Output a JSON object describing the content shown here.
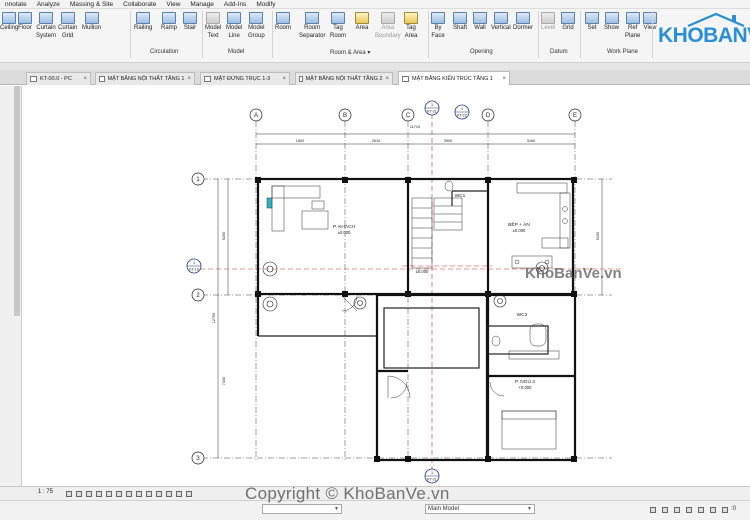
{
  "menu": [
    "nnotate",
    "Analyze",
    "Massing & Site",
    "Collaborate",
    "View",
    "Manage",
    "Add-Ins",
    "Modify"
  ],
  "ribbon": {
    "buttons": [
      {
        "label1": "Ceiling",
        "label2": "",
        "icon": "ceiling-icon",
        "color": "blue"
      },
      {
        "label1": "Floor",
        "label2": "",
        "icon": "floor-icon",
        "color": "blue"
      },
      {
        "label1": "Curtain",
        "label2": "System",
        "icon": "curtain-system-icon",
        "color": "blue"
      },
      {
        "label1": "Curtain",
        "label2": "Grid",
        "icon": "curtain-grid-icon",
        "color": "blue"
      },
      {
        "label1": "Mullion",
        "label2": "",
        "icon": "mullion-icon",
        "color": "blue"
      },
      {
        "label1": "Railing",
        "label2": "",
        "icon": "railing-icon",
        "color": "blue"
      },
      {
        "label1": "Ramp",
        "label2": "",
        "icon": "ramp-icon",
        "color": "blue"
      },
      {
        "label1": "Stair",
        "label2": "",
        "icon": "stair-icon",
        "color": "blue"
      },
      {
        "label1": "Model",
        "label2": "Text",
        "icon": "model-text-icon",
        "color": "gray"
      },
      {
        "label1": "Model",
        "label2": "Line",
        "icon": "model-line-icon",
        "color": "blue"
      },
      {
        "label1": "Model",
        "label2": "Group",
        "icon": "model-group-icon",
        "color": "blue"
      },
      {
        "label1": "Room",
        "label2": "",
        "icon": "room-icon",
        "color": "blue"
      },
      {
        "label1": "Room",
        "label2": "Separator",
        "icon": "room-separator-icon",
        "color": "blue"
      },
      {
        "label1": "Tag",
        "label2": "Room",
        "icon": "tag-room-icon",
        "color": "blue"
      },
      {
        "label1": "Area",
        "label2": "",
        "icon": "area-icon",
        "color": "yellow"
      },
      {
        "label1": "Area",
        "label2": "Boundary",
        "icon": "area-boundary-icon",
        "color": "gray",
        "dim": true
      },
      {
        "label1": "Tag",
        "label2": "Area",
        "icon": "tag-area-icon",
        "color": "yellow"
      },
      {
        "label1": "By",
        "label2": "Face",
        "icon": "by-face-icon",
        "color": "blue"
      },
      {
        "label1": "Shaft",
        "label2": "",
        "icon": "shaft-icon",
        "color": "blue"
      },
      {
        "label1": "Wall",
        "label2": "",
        "icon": "wall-opening-icon",
        "color": "blue"
      },
      {
        "label1": "Vertical",
        "label2": "",
        "icon": "vertical-opening-icon",
        "color": "blue"
      },
      {
        "label1": "Dormer",
        "label2": "",
        "icon": "dormer-icon",
        "color": "blue"
      },
      {
        "label1": "Level",
        "label2": "",
        "icon": "level-icon",
        "color": "gray",
        "dim": true
      },
      {
        "label1": "Grid",
        "label2": "",
        "icon": "grid-icon",
        "color": "blue"
      },
      {
        "label1": "Set",
        "label2": "",
        "icon": "set-icon",
        "color": "blue"
      },
      {
        "label1": "Show",
        "label2": "",
        "icon": "show-icon",
        "color": "blue"
      },
      {
        "label1": "Ref",
        "label2": "Plane",
        "icon": "ref-plane-icon",
        "color": "blue"
      },
      {
        "label1": "View",
        "label2": "",
        "icon": "viewer-icon",
        "color": "blue"
      }
    ],
    "groups": [
      "Circulation",
      "Model",
      "Room & Area ▾",
      "Opening",
      "Datum",
      "Work Plane"
    ]
  },
  "logo": {
    "text": "KHOBANVE",
    "color": "#2a8fd6"
  },
  "tabs": [
    {
      "label": "KT-00.0 - PC",
      "active": false
    },
    {
      "label": "MẶT BẰNG NỘI THẤT TẦNG 1",
      "active": false
    },
    {
      "label": "MẶT ĐỨNG TRỤC 1-3",
      "active": false
    },
    {
      "label": "MẶT BẰNG NỘI THẤT TẦNG 2",
      "active": false
    },
    {
      "label": "MẶT BẰNG KIẾN TRÚC TẦNG 1",
      "active": true
    }
  ],
  "tab_close": "×",
  "drawing": {
    "grid_cols": [
      "A",
      "B",
      "C",
      "D",
      "E"
    ],
    "grid_rows": [
      "1",
      "2",
      "3"
    ],
    "dims_top": [
      "1800",
      "2610",
      "3900",
      "3160"
    ],
    "dim_top_total": "11710",
    "dims_left": [
      "5200",
      "12700",
      "7400"
    ],
    "dim_right": "5200",
    "section_tags": [
      "KT-21",
      "KT-22",
      "KT-19",
      "KT-21"
    ],
    "section_nums": [
      "1",
      "1",
      "1",
      "1"
    ],
    "rooms": [
      {
        "name": "P. KHÁCH",
        "level": "±0.000"
      },
      {
        "name": "WC1",
        "level": ""
      },
      {
        "name": "BẾP + ĂN",
        "level": "±0.000"
      },
      {
        "name": "WC3",
        "level": ""
      },
      {
        "name": "P. NGỦ 3",
        "level": "+0.000"
      }
    ],
    "level_mark": "±0.000"
  },
  "watermarks": {
    "mid": "KhoBanVe.vn",
    "bottom": "Copyright © KhoBanVe.vn"
  },
  "status": {
    "scale": "1 : 75",
    "model": "Main Model",
    "design_option": "",
    "filter": ":0"
  }
}
